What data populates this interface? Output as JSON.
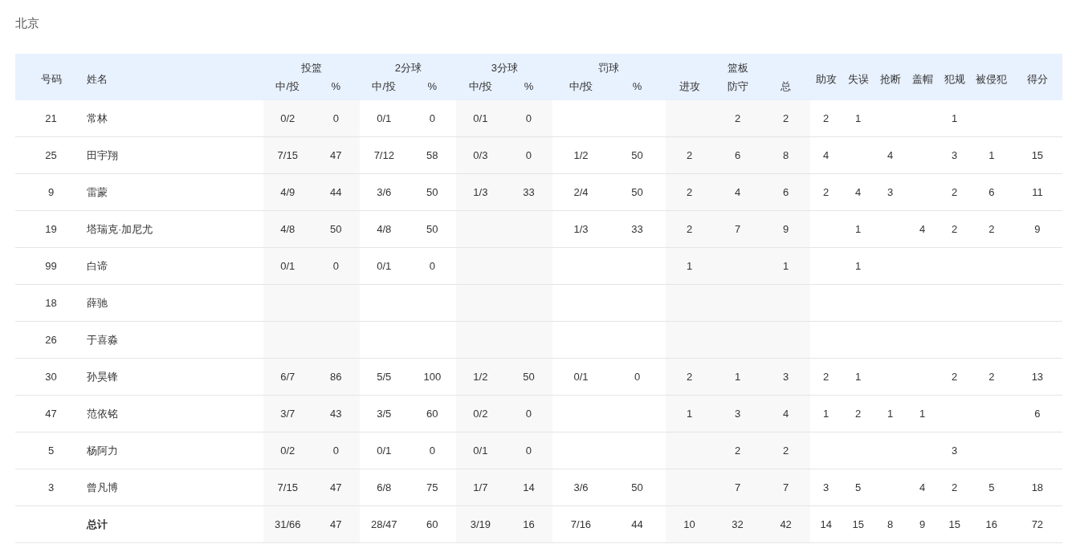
{
  "team": "北京",
  "columns": [
    {
      "label": "号码"
    },
    {
      "label": "姓名"
    },
    {
      "label": "投篮",
      "sub": [
        "中/投",
        "%"
      ]
    },
    {
      "label": "2分球",
      "sub": [
        "中/投",
        "%"
      ]
    },
    {
      "label": "3分球",
      "sub": [
        "中/投",
        "%"
      ]
    },
    {
      "label": "罚球",
      "sub": [
        "中/投",
        "%"
      ]
    },
    {
      "label": "篮板",
      "sub": [
        "进攻",
        "防守",
        "总"
      ]
    },
    {
      "label": "助攻"
    },
    {
      "label": "失误"
    },
    {
      "label": "抢断"
    },
    {
      "label": "盖帽"
    },
    {
      "label": "犯规"
    },
    {
      "label": "被侵犯"
    },
    {
      "label": "得分"
    }
  ],
  "rows": [
    {
      "kind": "player",
      "number": "21",
      "name": "常林",
      "cells": [
        "0/2",
        "0",
        "0/1",
        "0",
        "0/1",
        "0",
        null,
        null,
        null,
        "2",
        "2",
        "2",
        "1",
        null,
        null,
        "1",
        null,
        null
      ]
    },
    {
      "kind": "player",
      "number": "25",
      "name": "田宇翔",
      "cells": [
        "7/15",
        "47",
        "7/12",
        "58",
        "0/3",
        "0",
        "1/2",
        "50",
        "2",
        "6",
        "8",
        "4",
        null,
        "4",
        null,
        "3",
        "1",
        "15"
      ]
    },
    {
      "kind": "player",
      "number": "9",
      "name": "雷蒙",
      "cells": [
        "4/9",
        "44",
        "3/6",
        "50",
        "1/3",
        "33",
        "2/4",
        "50",
        "2",
        "4",
        "6",
        "2",
        "4",
        "3",
        null,
        "2",
        "6",
        "11"
      ]
    },
    {
      "kind": "player",
      "number": "19",
      "name": "塔瑞克·加尼尤",
      "cells": [
        "4/8",
        "50",
        "4/8",
        "50",
        null,
        null,
        "1/3",
        "33",
        "2",
        "7",
        "9",
        null,
        "1",
        null,
        "4",
        "2",
        "2",
        "9"
      ]
    },
    {
      "kind": "player",
      "number": "99",
      "name": "白谛",
      "cells": [
        "0/1",
        "0",
        "0/1",
        "0",
        null,
        null,
        null,
        null,
        "1",
        null,
        "1",
        null,
        "1",
        null,
        null,
        null,
        null,
        null
      ]
    },
    {
      "kind": "player",
      "number": "18",
      "name": "薛驰",
      "cells": [
        null,
        null,
        null,
        null,
        null,
        null,
        null,
        null,
        null,
        null,
        null,
        null,
        null,
        null,
        null,
        null,
        null,
        null
      ]
    },
    {
      "kind": "player",
      "number": "26",
      "name": "于喜淼",
      "cells": [
        null,
        null,
        null,
        null,
        null,
        null,
        null,
        null,
        null,
        null,
        null,
        null,
        null,
        null,
        null,
        null,
        null,
        null
      ]
    },
    {
      "kind": "player",
      "number": "30",
      "name": "孙昊锋",
      "cells": [
        "6/7",
        "86",
        "5/5",
        "100",
        "1/2",
        "50",
        "0/1",
        "0",
        "2",
        "1",
        "3",
        "2",
        "1",
        null,
        null,
        "2",
        "2",
        "13"
      ]
    },
    {
      "kind": "player",
      "number": "47",
      "name": "范依铭",
      "cells": [
        "3/7",
        "43",
        "3/5",
        "60",
        "0/2",
        "0",
        null,
        null,
        "1",
        "3",
        "4",
        "1",
        "2",
        "1",
        "1",
        null,
        null,
        "6"
      ]
    },
    {
      "kind": "player",
      "number": "5",
      "name": "杨阿力",
      "cells": [
        "0/2",
        "0",
        "0/1",
        "0",
        "0/1",
        "0",
        null,
        null,
        null,
        "2",
        "2",
        null,
        null,
        null,
        null,
        "3",
        null,
        null
      ]
    },
    {
      "kind": "player",
      "number": "3",
      "name": "曾凡博",
      "cells": [
        "7/15",
        "47",
        "6/8",
        "75",
        "1/7",
        "14",
        "3/6",
        "50",
        null,
        "7",
        "7",
        "3",
        "5",
        null,
        "4",
        "2",
        "5",
        "18"
      ]
    },
    {
      "kind": "total",
      "number": null,
      "name": "总计",
      "cells": [
        "31/66",
        "47",
        "28/47",
        "60",
        "3/19",
        "16",
        "7/16",
        "44",
        "10",
        "32",
        "42",
        "14",
        "15",
        "8",
        "9",
        "15",
        "16",
        "72"
      ]
    }
  ]
}
